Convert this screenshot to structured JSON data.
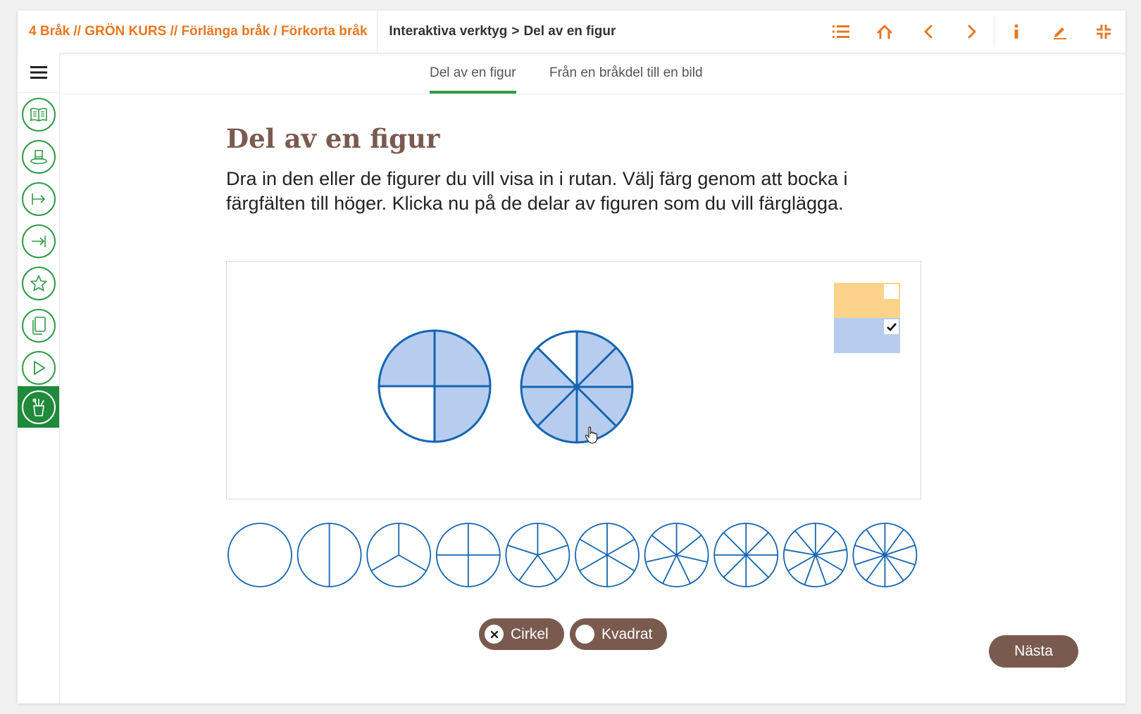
{
  "header": {
    "course_breadcrumb": "4 Bråk // GRÖN KURS // Förlänga bråk / Förkorta bråk",
    "tool_section": "Interaktiva verktyg",
    "tool_separator": ">",
    "tool_page": "Del av en figur",
    "icons": [
      "list-icon",
      "home-icon",
      "chevron-left-icon",
      "chevron-right-icon",
      "info-icon",
      "pencil-icon",
      "collapse-icon"
    ]
  },
  "sidebar": {
    "items": [
      {
        "icon": "book-icon"
      },
      {
        "icon": "hat-icon"
      },
      {
        "icon": "arrow-from-bar-icon"
      },
      {
        "icon": "arrow-to-bar-icon"
      },
      {
        "icon": "star-icon"
      },
      {
        "icon": "pages-icon"
      },
      {
        "icon": "play-icon"
      },
      {
        "icon": "tools-cup-icon",
        "active": true
      }
    ]
  },
  "tabs": [
    {
      "label": "Del av en figur",
      "active": true
    },
    {
      "label": "Från en bråkdel till en bild",
      "active": false
    }
  ],
  "main": {
    "title": "Del av en figur",
    "description": "Dra in den eller de figurer du vill visa in i rutan. Välj färg genom att bocka i färgfälten till höger. Klicka nu på de delar av figuren som du vill färglägga."
  },
  "workspace": {
    "colors": [
      {
        "name": "orange",
        "hex": "#fdd38b",
        "checked": false
      },
      {
        "name": "blue",
        "hex": "#b7cdef",
        "checked": true
      }
    ],
    "figures": [
      {
        "parts": 4,
        "filled": [
          0,
          1,
          3
        ]
      },
      {
        "parts": 8,
        "filled": [
          0,
          1,
          2,
          3,
          4,
          5,
          6
        ]
      }
    ]
  },
  "palette": {
    "circle_divisions": [
      1,
      2,
      3,
      4,
      5,
      6,
      7,
      8,
      9,
      10
    ]
  },
  "shape_toggle": {
    "options": [
      {
        "label": "Cirkel",
        "selected": true
      },
      {
        "label": "Kvadrat",
        "selected": false
      }
    ]
  },
  "footer": {
    "next_label": "Nästa"
  },
  "colors": {
    "accent_orange": "#e87722",
    "accent_green": "#2e9b47",
    "brown": "#7a5a4f",
    "stroke_blue": "#1565b0",
    "fill_blue": "#b7cdef"
  }
}
